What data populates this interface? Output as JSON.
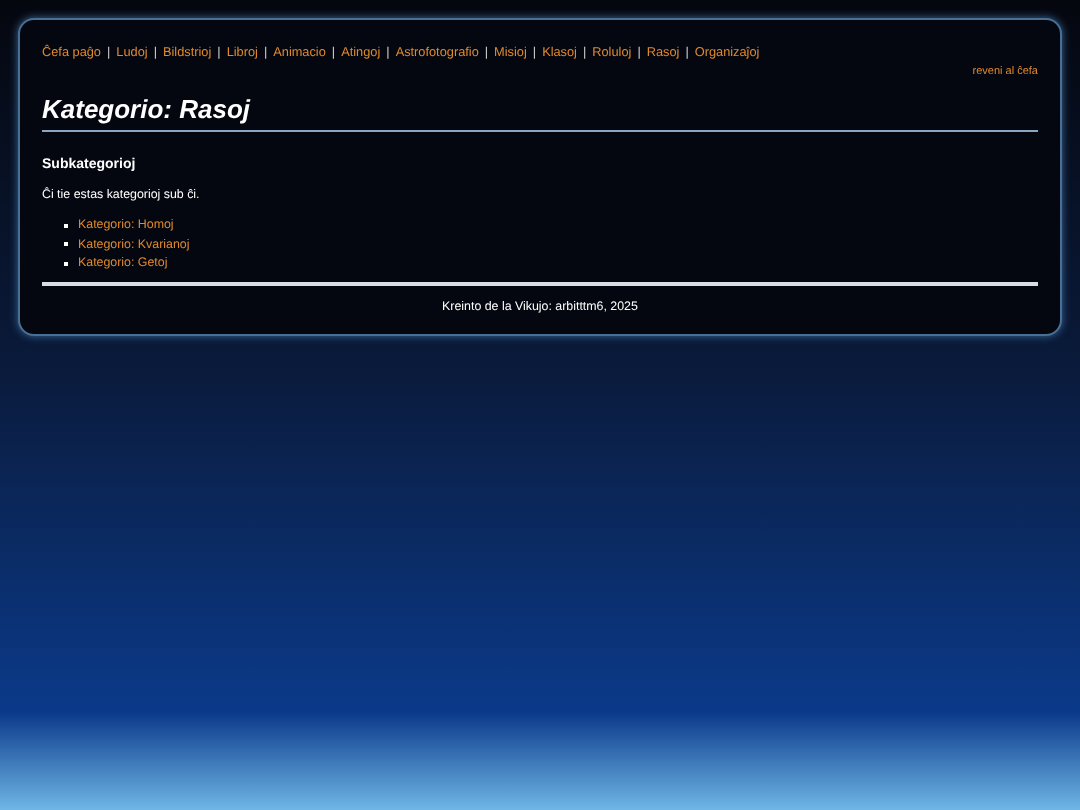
{
  "nav": {
    "separator": "|",
    "links": [
      "Ĉefa paĝo",
      "Ludoj",
      "Bildstrioj",
      "Libroj",
      "Animacio",
      "Atingoj",
      "Astrofotografio",
      "Misioj",
      "Klasoj",
      "Roluloj",
      "Rasoj",
      "Organizaĵoj"
    ]
  },
  "back_link": "reveni al ĉefa",
  "title": "Kategorio: Rasoj",
  "section_heading": "Subkategorioj",
  "intro": "Ĉi tie estas kategorioj sub ĉi.",
  "subcategories": [
    "Kategorio: Homoj",
    "Kategorio: Kvarianoj",
    "Kategorio: Getoj"
  ],
  "footer": "Kreinto de la Vikujo: arbitttm6, 2025"
}
